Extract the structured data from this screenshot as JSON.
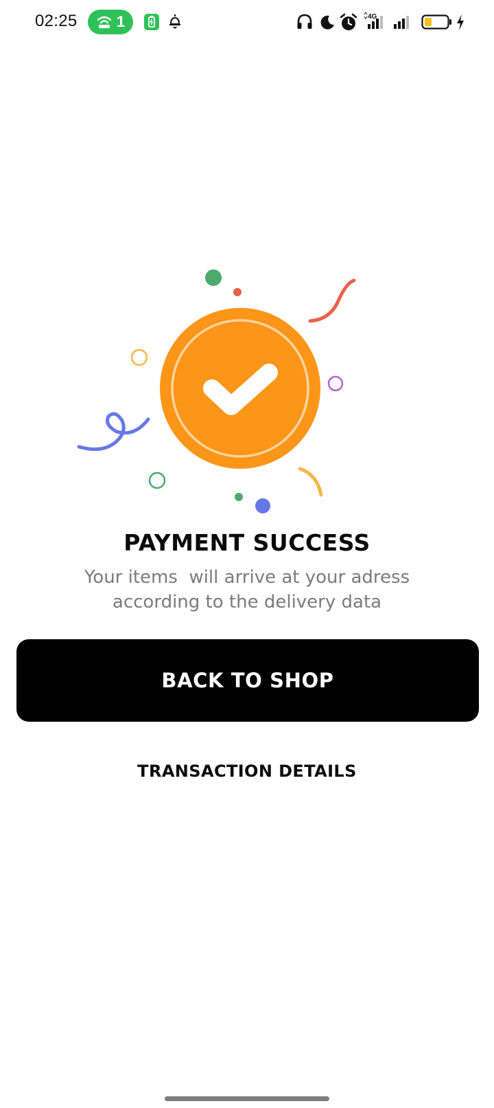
{
  "status_bar": {
    "time": "02:25",
    "hotspot_count": "1",
    "network_label": "4G",
    "icons": [
      "hotspot-icon",
      "battery-saver-app-icon",
      "notification-bell-icon",
      "headphones-icon",
      "moon-icon",
      "alarm-icon",
      "signal-4g-icon",
      "signal-icon",
      "battery-icon",
      "charging-icon"
    ],
    "battery_level": 0.3
  },
  "illustration": {
    "icon": "check-circle-icon",
    "colors": {
      "badge": "#fd9518",
      "ring": "#ffd59a",
      "confetti_green": "#4caa6d",
      "confetti_red": "#e8624b",
      "confetti_blue": "#6678e8",
      "confetti_yellow": "#f2b84b",
      "confetti_purple": "#b65fd6"
    }
  },
  "content": {
    "title": "PAYMENT SUCCESS",
    "subtitle": "Your items  will arrive at your adress\naccording to the delivery data"
  },
  "actions": {
    "back_to_shop": "BACK TO SHOP",
    "transaction_details": "TRANSACTION DETAILS"
  }
}
